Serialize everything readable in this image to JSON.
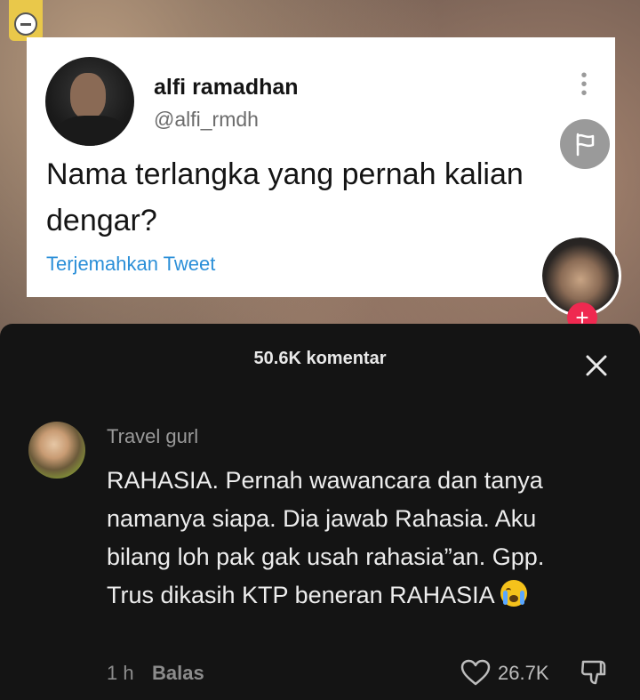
{
  "tweet": {
    "name": "alfi ramadhan",
    "handle": "@alfi_rmdh",
    "text": "Nama terlangka yang pernah kalian dengar?",
    "translate_link": "Terjemahkan Tweet",
    "more_icon": "more-vertical-icon"
  },
  "side_actions": {
    "report_icon": "flag-icon",
    "follow_icon": "plus-icon",
    "follow_label": "+"
  },
  "comments_sheet": {
    "title": "50.6K komentar",
    "close_icon": "close-icon",
    "comment": {
      "username": "Travel gurl",
      "text": "RAHASIA. Pernah wawancara dan tanya namanya siapa. Dia jawab Rahasia. Aku bilang loh pak gak usah rahasia”an. Gpp. Trus dikasih KTP beneran RAHASIA",
      "emoji": "crying-face-emoji",
      "time": "1 h",
      "reply_label": "Balas",
      "like_count": "26.7K"
    }
  },
  "colors": {
    "sheet_bg": "#141414",
    "accent_red": "#ef2950",
    "link_blue": "#2b8fd8"
  }
}
